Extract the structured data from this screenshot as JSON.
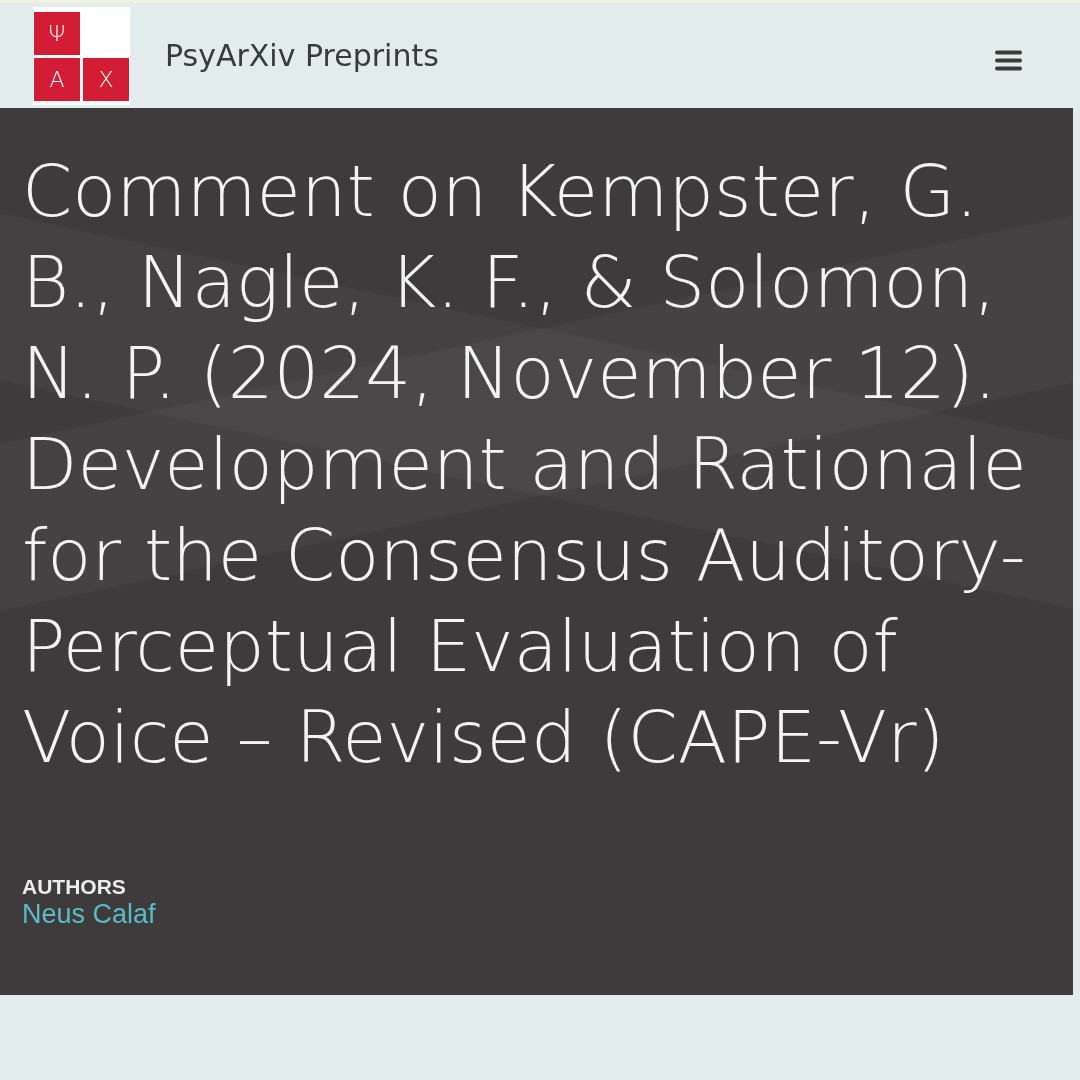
{
  "header": {
    "logo_letters": [
      "Ψ",
      "A",
      "X"
    ],
    "site_name": "PsyArXiv Preprints"
  },
  "banner": {
    "title": "Comment on Kempster, G. B., Nagle, K. F., & Solomon, N. P. (2024, November 12). Development and Rationale for the Consensus Auditory-Perceptual Evaluation of Voice – Revised (CAPE-Vr)",
    "authors_label": "AUTHORS",
    "authors": [
      "Neus Calaf"
    ]
  }
}
